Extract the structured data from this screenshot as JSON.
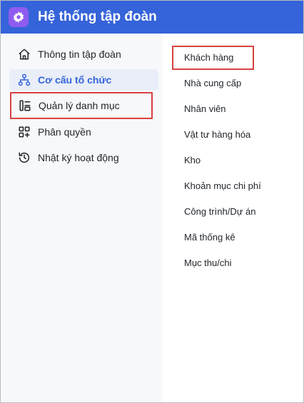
{
  "app": {
    "title": "Hệ thống tập đoàn",
    "logo_icon": "gear-icon",
    "brand_color": "#3563d9",
    "logo_color": "#8e5cf0",
    "highlight_color": "#d94141"
  },
  "sidebar": {
    "items": [
      {
        "label": "Thông tin tập đoàn",
        "icon": "home-icon"
      },
      {
        "label": "Cơ cấu tổ chức",
        "icon": "org-structure-icon",
        "active": true
      },
      {
        "label": "Quản lý danh mục",
        "icon": "category-list-icon",
        "highlighted": true
      },
      {
        "label": "Phân quyền",
        "icon": "grid-plus-icon"
      },
      {
        "label": "Nhật ký hoạt động",
        "icon": "history-icon"
      }
    ]
  },
  "submenu": {
    "items": [
      {
        "label": "Khách hàng",
        "highlighted": true
      },
      {
        "label": "Nhà cung cấp"
      },
      {
        "label": "Nhân viên"
      },
      {
        "label": "Vật tư hàng hóa"
      },
      {
        "label": "Kho"
      },
      {
        "label": "Khoản mục chi phí"
      },
      {
        "label": "Công trình/Dự án"
      },
      {
        "label": "Mã thống kê"
      },
      {
        "label": "Mục thu/chi"
      }
    ]
  }
}
